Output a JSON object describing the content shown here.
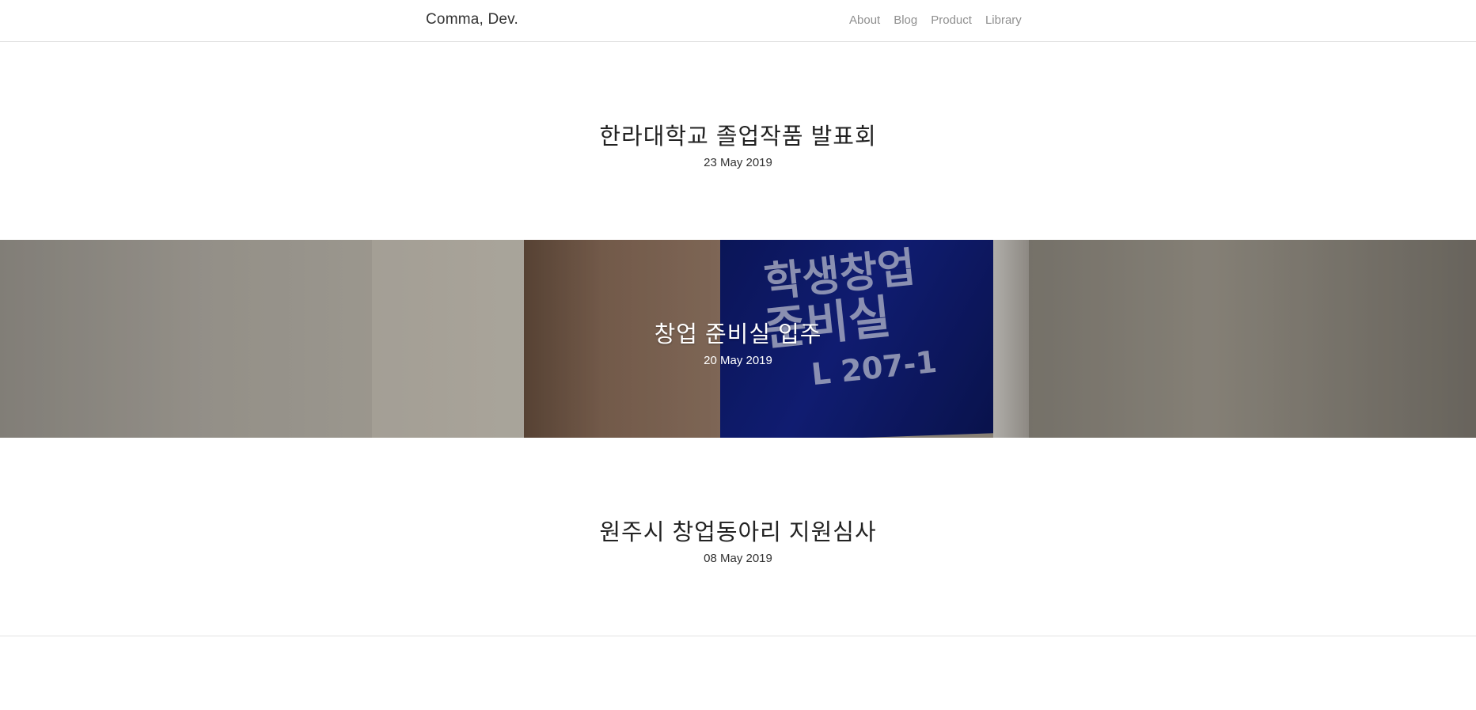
{
  "site": {
    "brand": "Comma, Dev."
  },
  "nav": {
    "items": [
      {
        "label": "About"
      },
      {
        "label": "Blog"
      },
      {
        "label": "Product"
      },
      {
        "label": "Library"
      }
    ]
  },
  "posts": [
    {
      "title": "한라대학교 졸업작품 발표회",
      "date": "23 May 2019",
      "has_image": false
    },
    {
      "title": "창업 준비실 입주",
      "date": "20 May 2019",
      "has_image": true,
      "image": {
        "sign_line1": "학생창업",
        "sign_line2": "준비실",
        "sign_line3": "L 207-1"
      }
    },
    {
      "title": "원주시 창업동아리 지원심사",
      "date": "08 May 2019",
      "has_image": false
    }
  ],
  "colors": {
    "text": "#222222",
    "nav_link": "#8f8f8f",
    "divider": "#e2e2e2",
    "sign_blue": "#14238a"
  }
}
